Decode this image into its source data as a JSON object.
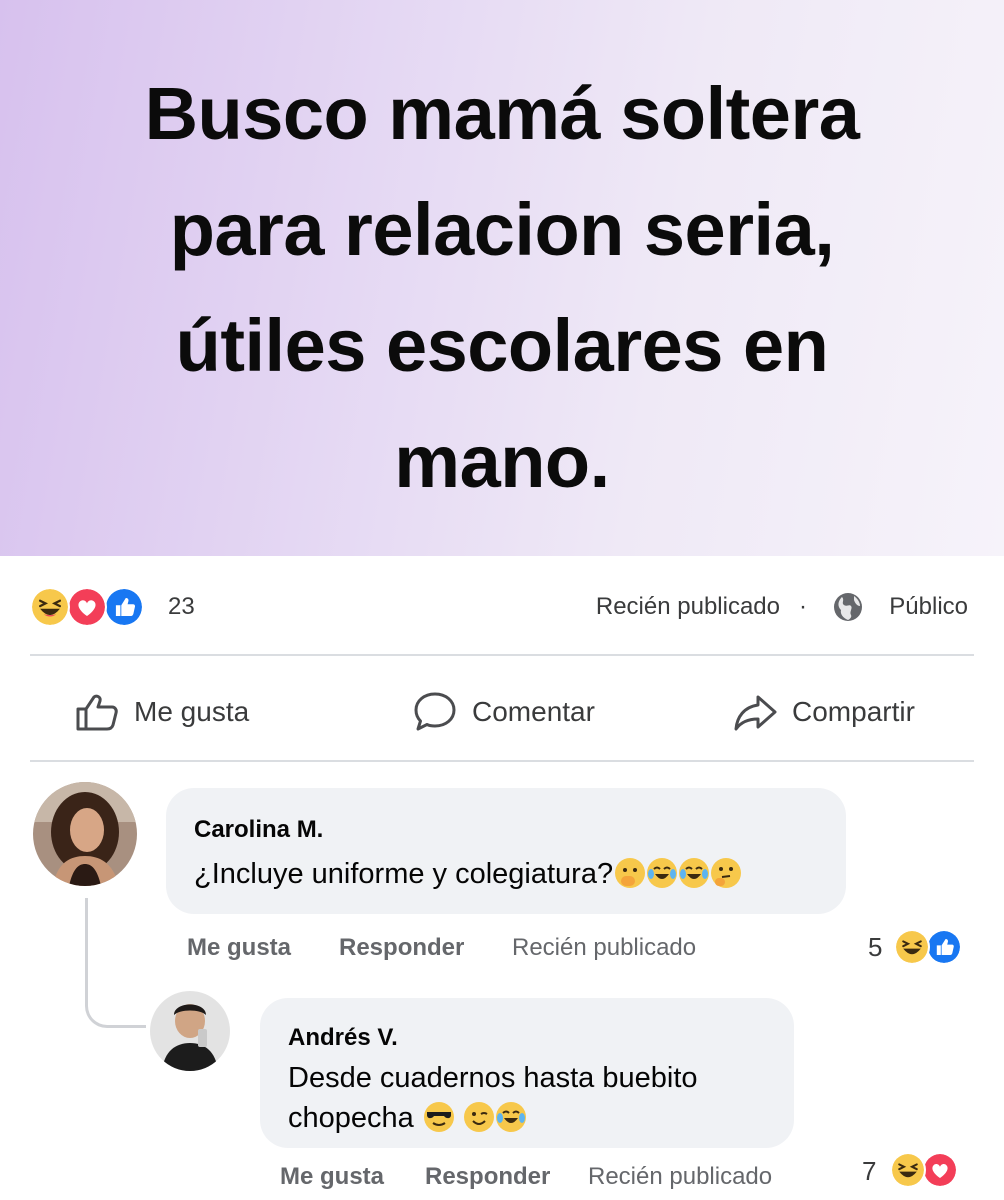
{
  "post": {
    "text_lines": [
      "Busco mamá soltera",
      "para relacion seria,",
      "útiles escolares en",
      "mano."
    ],
    "background_gradient": [
      "#d7c1ee",
      "#f6f3fa"
    ]
  },
  "stats": {
    "reaction_icons": [
      "laugh-emoji-icon",
      "love-heart-icon",
      "like-thumb-icon"
    ],
    "reaction_count": "23",
    "posted_time": "Recién publicado",
    "separator": "·",
    "visibility_icon": "globe-icon",
    "visibility": "Público"
  },
  "actions": {
    "like_label": "Me gusta",
    "comment_label": "Comentar",
    "share_label": "Compartir"
  },
  "comments": [
    {
      "author": "Carolina M.",
      "text": "¿Incluye uniforme y colegiatura?",
      "emojis": [
        "face-with-hand-over-mouth",
        "tears-of-joy",
        "tears-of-joy",
        "thinking-face"
      ],
      "like_label": "Me gusta",
      "reply_label": "Responder",
      "time": "Recién publicado",
      "reaction_count": "5",
      "reaction_icons": [
        "laugh-emoji-icon",
        "like-thumb-icon"
      ]
    },
    {
      "author": "Andrés V.",
      "text_line1": "Desde cuadernos hasta buebito",
      "text_line2": "chopecha",
      "emojis": [
        "sunglasses-face",
        "winking-face",
        "tears-of-joy"
      ],
      "like_label": "Me gusta",
      "reply_label": "Responder",
      "time": "Recién publicado",
      "reaction_count": "7",
      "reaction_icons": [
        "laugh-emoji-icon",
        "love-heart-icon"
      ]
    }
  ],
  "colors": {
    "like_blue": "#1877f2",
    "love_red": "#f33e58",
    "haha_yellow": "#f7c84b",
    "bubble_gray": "#f0f2f5",
    "meta_gray": "#65676b"
  }
}
